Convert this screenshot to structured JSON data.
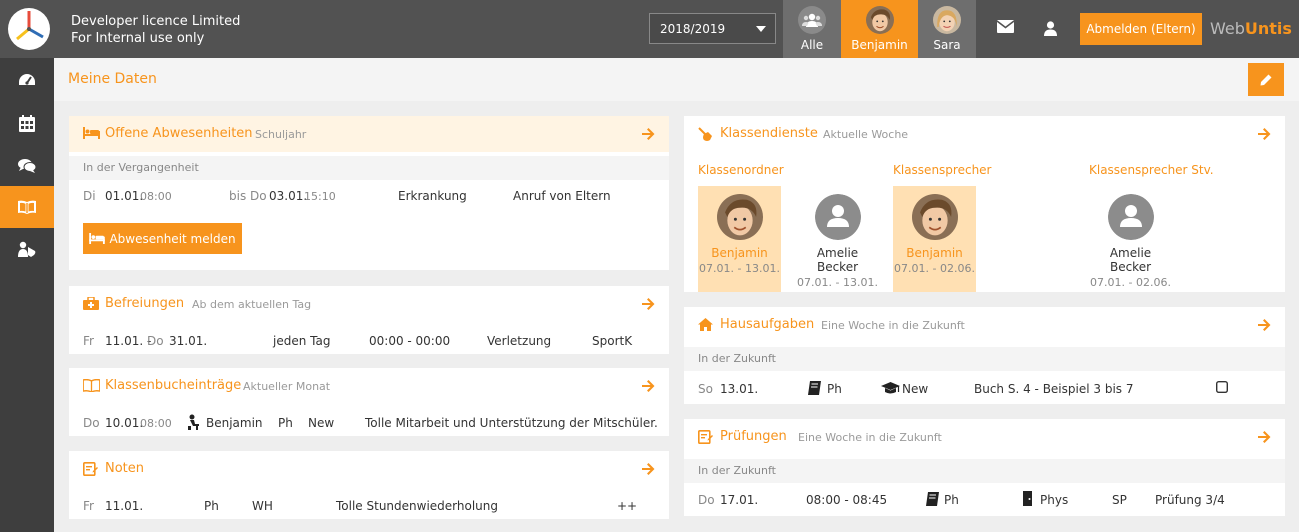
{
  "org": {
    "line1": "Developer licence Limited",
    "line2": "For Internal use only"
  },
  "school_year": "2018/2019",
  "person_tabs": [
    {
      "label": "Alle",
      "icon": "group-icon",
      "active": false
    },
    {
      "label": "Benjamin",
      "icon": "student-photo",
      "active": true
    },
    {
      "label": "Sara",
      "icon": "student-photo",
      "active": false
    }
  ],
  "logout_label": "Abmelden (Eltern)",
  "brand": {
    "part1": "Web",
    "part2": "Untis"
  },
  "page_title": "Meine Daten",
  "colors": {
    "accent": "#f7941d",
    "topbar": "#525252",
    "sidebar": "#3e3e3e",
    "highlight": "#ffe0b3"
  },
  "absences": {
    "title": "Offene Abwesenheiten",
    "subtitle": "Schuljahr",
    "section": "In der Vergangenheit",
    "row": {
      "from_day": "Di",
      "from_date": "01.01.",
      "from_time": "08:00",
      "to_day": "bis Do",
      "to_date": "03.01.",
      "to_time": "15:10",
      "reason": "Erkrankung",
      "note": "Anruf von Eltern"
    },
    "report_button": "Abwesenheit melden"
  },
  "exemptions": {
    "title": "Befreiungen",
    "subtitle": "Ab dem aktuellen Tag",
    "row": {
      "day": "Fr",
      "from_date": "11.01. -",
      "to_day": "Do",
      "to_date": "31.01.",
      "freq": "jeden Tag",
      "time": "00:00 - 00:00",
      "reason": "Verletzung",
      "subject": "SportK"
    }
  },
  "classbook": {
    "title": "Klassenbucheinträge",
    "subtitle": "Aktueller Monat",
    "row": {
      "day": "Do",
      "date": "10.01.",
      "time": "08:00",
      "student": "Benjamin",
      "subject": "Ph",
      "teacher": "New",
      "text": "Tolle Mitarbeit und Unterstützung der Mitschüler."
    }
  },
  "grades": {
    "title": "Noten",
    "row": {
      "day": "Fr",
      "date": "11.01.",
      "subject": "Ph",
      "type": "WH",
      "text": "Tolle Stundenwiederholung",
      "grade": "++"
    }
  },
  "duties": {
    "title": "Klassendienste",
    "subtitle": "Aktuelle Woche",
    "roles": [
      {
        "label": "Klassenordner",
        "people": [
          {
            "name": "Benjamin",
            "dates": "07.01. - 13.01.",
            "highlight": true
          },
          {
            "name": "Amelie Becker",
            "dates": "07.01. - 13.01.",
            "highlight": false
          }
        ]
      },
      {
        "label": "Klassensprecher",
        "people": [
          {
            "name": "Benjamin",
            "dates": "07.01. - 02.06.",
            "highlight": true
          }
        ]
      },
      {
        "label": "Klassensprecher Stv.",
        "people": [
          {
            "name": "Amelie Becker",
            "dates": "07.01. - 02.06.",
            "highlight": false
          }
        ]
      }
    ]
  },
  "homework": {
    "title": "Hausaufgaben",
    "subtitle": "Eine Woche in die Zukunft",
    "section": "In der Zukunft",
    "row": {
      "day": "So",
      "date": "13.01.",
      "subject": "Ph",
      "teacher": "New",
      "text": "Buch S. 4 - Beispiel 3 bis 7",
      "done": false
    }
  },
  "exams": {
    "title": "Prüfungen",
    "subtitle": "Eine Woche in die Zukunft",
    "section": "In der Zukunft",
    "row": {
      "day": "Do",
      "date": "17.01.",
      "time": "08:00 - 08:45",
      "subject": "Ph",
      "room": "Phys",
      "teacher": "SP",
      "name": "Prüfung 3/4"
    }
  }
}
